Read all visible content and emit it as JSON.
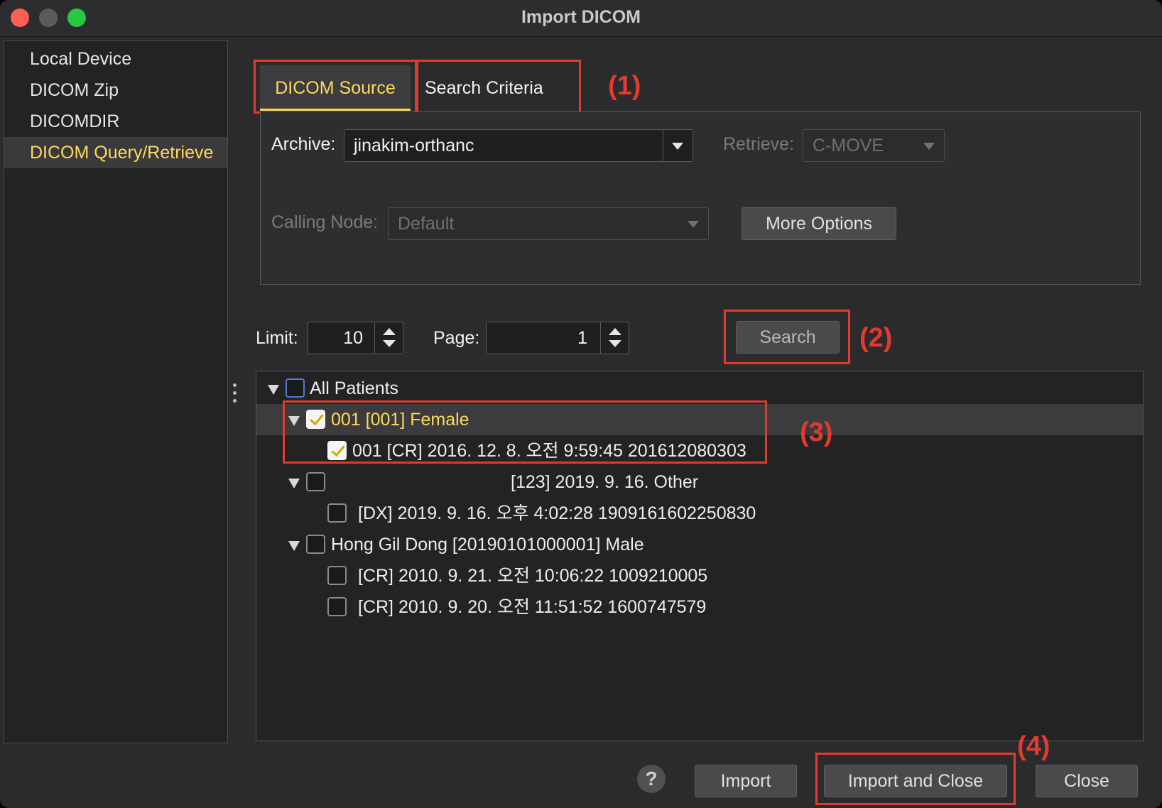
{
  "window": {
    "title": "Import DICOM"
  },
  "sidebar": {
    "items": [
      {
        "label": "Local Device"
      },
      {
        "label": "DICOM Zip"
      },
      {
        "label": "DICOMDIR"
      },
      {
        "label": "DICOM Query/Retrieve",
        "active": true
      }
    ]
  },
  "tabs": [
    {
      "label": "DICOM Source",
      "active": true
    },
    {
      "label": "Search Criteria"
    }
  ],
  "source": {
    "archive_label": "Archive:",
    "archive_value": "jinakim-orthanc",
    "retrieve_label": "Retrieve:",
    "retrieve_value": "C-MOVE",
    "calling_node_label": "Calling Node:",
    "calling_node_value": "Default",
    "more_options_label": "More Options"
  },
  "paging": {
    "limit_label": "Limit:",
    "limit_value": "10",
    "page_label": "Page:",
    "page_value": "1",
    "search_label": "Search"
  },
  "annotations": [
    "(1)",
    "(2)",
    "(3)",
    "(4)"
  ],
  "tree": {
    "rows": [
      {
        "text": "All Patients",
        "checked": false
      },
      {
        "text": "001 [001]  Female",
        "checked": true,
        "selected": true
      },
      {
        "text": "001 [CR] 2016. 12. 8. 오전 9:59:45 201612080303",
        "checked": true
      },
      {
        "text": "[123] 2019. 9. 16. Other",
        "checked": false
      },
      {
        "text": "[DX] 2019. 9. 16. 오후 4:02:28 1909161602250830",
        "checked": false
      },
      {
        "text": "Hong Gil Dong [20190101000001]  Male",
        "checked": false
      },
      {
        "text": "[CR] 2010. 9. 21. 오전 10:06:22 1009210005",
        "checked": false
      },
      {
        "text": "[CR] 2010. 9. 20. 오전 11:51:52 1600747579",
        "checked": false
      }
    ]
  },
  "footer": {
    "help_label": "?",
    "import_label": "Import",
    "import_close_label": "Import and Close",
    "close_label": "Close"
  },
  "colors": {
    "accent": "#ffd95a",
    "annotation": "#e23b2d",
    "background": "#2b2b2d"
  }
}
